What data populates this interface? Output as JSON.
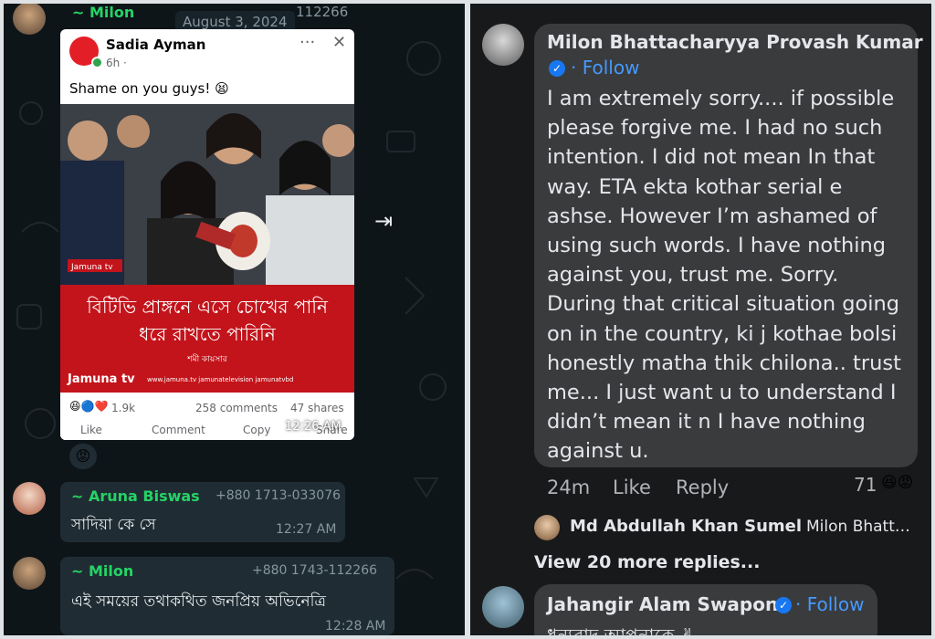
{
  "left_chat": {
    "msg1": {
      "sender": "~ Milon",
      "phone_partial": "112266",
      "date_badge": "August 3, 2024",
      "shared_post": {
        "author": "Sadia Ayman",
        "time": "6h ·",
        "text": "Shame on you guys! 😫",
        "caption_line1": "বিটিভি প্রাঙ্গনে এসে চোখের পানি",
        "caption_line2": "ধরে রাখতে পারিনি",
        "caption_credit": "শমী কায়সার",
        "channel_logo": "Jamuna tv",
        "links": "www.jamuna.tv   jamunatelevision   jamunatvbd",
        "reactions": "1.9k",
        "comments": "258 comments",
        "shares": "47 shares",
        "like": "Like",
        "comment": "Comment",
        "copy": "Copy",
        "share": "Share"
      },
      "time": "12:26 AM",
      "reaction_emoji": "😡",
      "forward_icon": "forward-icon"
    },
    "msg2": {
      "sender": "~ Aruna Biswas",
      "phone": "+880 1713-033076",
      "text": "সাদিয়া কে সে",
      "time": "12:27 AM"
    },
    "msg3": {
      "sender": "~ Milon",
      "phone": "+880 1743-112266",
      "text": "এই সময়ের তথাকথিত জনপ্রিয় অভিনেত্রি",
      "time": "12:28 AM"
    }
  },
  "right_fb": {
    "comment": {
      "author": "Milon Bhattacharyya Provash Kumar",
      "follow": "Follow",
      "lines": [
        "I am extremely sorry.... if possible",
        "please forgive me. I had no such",
        "intention. I did not mean In that",
        "way. ETA ekta kothar serial e",
        "ashse. However I’m ashamed of",
        "using such words. I have nothing",
        "against you, trust me. Sorry.",
        "During that critical situation going",
        "on in the country, ki j kothae bolsi",
        "honestly matha thik chilona.. trust",
        "me... I just want u to understand I",
        "didn’t mean it n I have nothing",
        "against u."
      ],
      "time": "24m",
      "like": "Like",
      "reply": "Reply",
      "reaction_count": "71",
      "reaction_emojis": "😆😡"
    },
    "sub_reply": {
      "author": "Md Abdullah Khan Sumel",
      "preview": "Milon Bhatt…"
    },
    "view_more": "View 20 more replies...",
    "next_comment": {
      "author": "Jahangir Alam Swapon",
      "follow": "Follow",
      "text_partial": "ধন্যবাদ আপনাকে ✌"
    }
  },
  "colors": {
    "whatsapp_bg": "#0e1519",
    "bubble": "#1f2c33",
    "sender_green": "#25d366",
    "fb_bg": "#18191a",
    "fb_comment": "#3a3b3c",
    "fb_link": "#4599ff",
    "jamuna_red": "#c3141b"
  }
}
